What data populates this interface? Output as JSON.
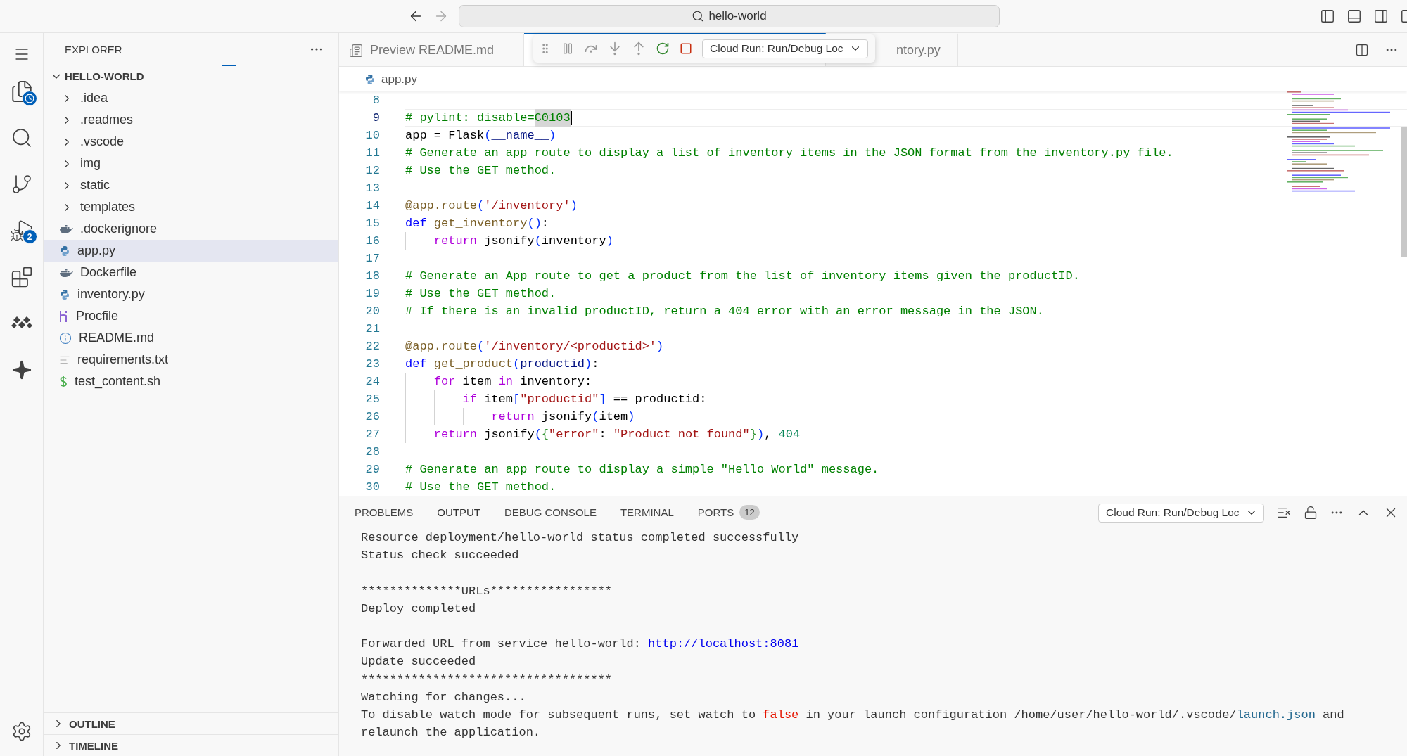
{
  "title_bar": {
    "search": "hello-world"
  },
  "activity_bar": {
    "run_badge": "2"
  },
  "explorer": {
    "title": "EXPLORER",
    "folder": "HELLO-WORLD",
    "items": [
      {
        "name": ".idea",
        "kind": "folder",
        "selected": false
      },
      {
        "name": ".readmes",
        "kind": "folder",
        "selected": false
      },
      {
        "name": ".vscode",
        "kind": "folder",
        "selected": false
      },
      {
        "name": "img",
        "kind": "folder",
        "selected": false
      },
      {
        "name": "static",
        "kind": "folder",
        "selected": false
      },
      {
        "name": "templates",
        "kind": "folder",
        "selected": false
      },
      {
        "name": ".dockerignore",
        "kind": "docker",
        "selected": false
      },
      {
        "name": "app.py",
        "kind": "python",
        "selected": true
      },
      {
        "name": "Dockerfile",
        "kind": "docker",
        "selected": false
      },
      {
        "name": "inventory.py",
        "kind": "python",
        "selected": false
      },
      {
        "name": "Procfile",
        "kind": "heroku",
        "selected": false
      },
      {
        "name": "README.md",
        "kind": "info",
        "selected": false
      },
      {
        "name": "requirements.txt",
        "kind": "text",
        "selected": false
      },
      {
        "name": "test_content.sh",
        "kind": "shell",
        "selected": false
      }
    ],
    "sections": [
      {
        "title": "OUTLINE"
      },
      {
        "title": "TIMELINE"
      }
    ]
  },
  "editor_tabs": [
    {
      "label": "Preview README.md",
      "kind": "preview",
      "selected": false
    },
    {
      "kind": "file",
      "selected": true
    },
    {
      "label": "ntory.py",
      "kind": "file",
      "selected": false
    }
  ],
  "debug_toolbar": {
    "configuration": "Cloud Run: Run/Debug Loc"
  },
  "breadcrumb": "app.py",
  "code": {
    "lines": [
      {
        "number": "8",
        "current": false
      },
      {
        "number": "9",
        "current": true,
        "tokens": [
          {
            "kind": "comment",
            "text": "# pylint: disable="
          },
          {
            "kind": "comment",
            "text": "C0103",
            "highlighted": true
          }
        ]
      },
      {
        "number": "10",
        "current": false,
        "tokens": [
          {
            "kind": "plain",
            "text": "app = Flask"
          },
          {
            "kind": "bracket",
            "text": "("
          },
          {
            "kind": "param",
            "text": "__name__"
          },
          {
            "kind": "bracket",
            "text": ")"
          }
        ]
      },
      {
        "number": "11",
        "current": false,
        "tokens": [
          {
            "kind": "comment",
            "text": "# Generate an app route to display a list of inventory items in the JSON format from the inventory.py file."
          }
        ]
      },
      {
        "number": "12",
        "current": false,
        "tokens": [
          {
            "kind": "comment",
            "text": "# Use the GET method."
          }
        ]
      },
      {
        "number": "13",
        "current": false
      },
      {
        "number": "14",
        "current": false,
        "tokens": [
          {
            "kind": "func",
            "text": "@app.route"
          },
          {
            "kind": "bracket",
            "text": "("
          },
          {
            "kind": "string",
            "text": "'/inventory'"
          },
          {
            "kind": "bracket",
            "text": ")"
          }
        ]
      },
      {
        "number": "15",
        "current": false,
        "tokens": [
          {
            "kind": "keyword",
            "text": "def "
          },
          {
            "kind": "func",
            "text": "get_inventory"
          },
          {
            "kind": "bracket",
            "text": "()"
          },
          {
            "kind": "plain",
            "text": ":"
          }
        ]
      },
      {
        "number": "16",
        "current": false,
        "tokens": [
          {
            "kind": "control",
            "text": "    return"
          },
          {
            "kind": "plain",
            "text": " jsonify"
          },
          {
            "kind": "bracket",
            "text": "("
          },
          {
            "kind": "plain",
            "text": "inventory"
          },
          {
            "kind": "bracket",
            "text": ")"
          }
        ]
      },
      {
        "number": "17",
        "current": false
      },
      {
        "number": "18",
        "current": false,
        "tokens": [
          {
            "kind": "comment",
            "text": "# Generate an App route to get a product from the list of inventory items given the productID."
          }
        ]
      },
      {
        "number": "19",
        "current": false,
        "tokens": [
          {
            "kind": "comment",
            "text": "# Use the GET method."
          }
        ]
      },
      {
        "number": "20",
        "current": false,
        "tokens": [
          {
            "kind": "comment",
            "text": "# If there is an invalid productID, return a 404 error with an error message in the JSON."
          }
        ]
      },
      {
        "number": "21",
        "current": false
      },
      {
        "number": "22",
        "current": false,
        "tokens": [
          {
            "kind": "func",
            "text": "@app.route"
          },
          {
            "kind": "bracket",
            "text": "("
          },
          {
            "kind": "string",
            "text": "'/inventory/<productid>'"
          },
          {
            "kind": "bracket",
            "text": ")"
          }
        ]
      },
      {
        "number": "23",
        "current": false,
        "tokens": [
          {
            "kind": "keyword",
            "text": "def "
          },
          {
            "kind": "func",
            "text": "get_product"
          },
          {
            "kind": "bracket",
            "text": "("
          },
          {
            "kind": "param",
            "text": "productid"
          },
          {
            "kind": "bracket",
            "text": ")"
          },
          {
            "kind": "plain",
            "text": ":"
          }
        ]
      },
      {
        "number": "24",
        "current": false,
        "tokens": [
          {
            "kind": "control",
            "text": "    for"
          },
          {
            "kind": "plain",
            "text": " item "
          },
          {
            "kind": "control",
            "text": "in"
          },
          {
            "kind": "plain",
            "text": " inventory:"
          }
        ]
      },
      {
        "number": "25",
        "current": false,
        "tokens": [
          {
            "kind": "control",
            "text": "        if"
          },
          {
            "kind": "plain",
            "text": " item"
          },
          {
            "kind": "bracket",
            "text": "["
          },
          {
            "kind": "string",
            "text": "\"productid\""
          },
          {
            "kind": "bracket",
            "text": "]"
          },
          {
            "kind": "plain",
            "text": " == productid:"
          }
        ]
      },
      {
        "number": "26",
        "current": false,
        "tokens": [
          {
            "kind": "control",
            "text": "            return"
          },
          {
            "kind": "plain",
            "text": " jsonify"
          },
          {
            "kind": "bracket",
            "text": "("
          },
          {
            "kind": "plain",
            "text": "item"
          },
          {
            "kind": "bracket",
            "text": ")"
          }
        ]
      },
      {
        "number": "27",
        "current": false,
        "tokens": [
          {
            "kind": "control",
            "text": "    return"
          },
          {
            "kind": "plain",
            "text": " jsonify"
          },
          {
            "kind": "bracket",
            "text": "("
          },
          {
            "kind": "brace",
            "text": "{"
          },
          {
            "kind": "string",
            "text": "\"error\""
          },
          {
            "kind": "plain",
            "text": ": "
          },
          {
            "kind": "string",
            "text": "\"Product not found\""
          },
          {
            "kind": "brace",
            "text": "}"
          },
          {
            "kind": "bracket",
            "text": ")"
          },
          {
            "kind": "plain",
            "text": ", "
          },
          {
            "kind": "number",
            "text": "404"
          }
        ]
      },
      {
        "number": "28",
        "current": false
      },
      {
        "number": "29",
        "current": false,
        "tokens": [
          {
            "kind": "comment",
            "text": "# Generate an app route to display a simple \"Hello World\" message."
          }
        ]
      },
      {
        "number": "30",
        "current": false,
        "tokens": [
          {
            "kind": "comment",
            "text": "# Use the GET method."
          }
        ]
      }
    ]
  },
  "panel": {
    "tabs": [
      {
        "label": "PROBLEMS",
        "selected": false
      },
      {
        "label": "OUTPUT",
        "selected": true
      },
      {
        "label": "DEBUG CONSOLE",
        "selected": false
      },
      {
        "label": "TERMINAL",
        "selected": false
      },
      {
        "label": "PORTS",
        "selected": false,
        "badge": "12"
      }
    ],
    "channel": "Cloud Run: Run/Debug Loc",
    "output": [
      {
        "segments": [
          {
            "kind": "text",
            "text": "Resource deployment/hello-world status completed successfully"
          }
        ]
      },
      {
        "segments": [
          {
            "kind": "text",
            "text": "Status check succeeded"
          }
        ]
      },
      {
        "kind": "blank"
      },
      {
        "segments": [
          {
            "kind": "text",
            "text": "**************URLs*****************"
          }
        ]
      },
      {
        "segments": [
          {
            "kind": "text",
            "text": "Deploy completed"
          }
        ]
      },
      {
        "kind": "blank"
      },
      {
        "segments": [
          {
            "kind": "text",
            "text": "Forwarded URL from service hello-world: "
          },
          {
            "kind": "link",
            "text": "http://localhost:8081"
          }
        ]
      },
      {
        "segments": [
          {
            "kind": "text",
            "text": "Update succeeded"
          }
        ]
      },
      {
        "segments": [
          {
            "kind": "text",
            "text": "***********************************"
          }
        ]
      },
      {
        "segments": [
          {
            "kind": "text",
            "text": "Watching for changes..."
          }
        ]
      },
      {
        "segments": [
          {
            "kind": "text",
            "text": "To disable watch mode for subsequent runs, set watch to "
          },
          {
            "kind": "literal",
            "text": "false"
          },
          {
            "kind": "text",
            "text": " in your launch configuration "
          },
          {
            "kind": "path",
            "text": "/home/user/hello-world/.vscode/"
          },
          {
            "kind": "file",
            "text": "launch.json"
          },
          {
            "kind": "text",
            "text": " and"
          }
        ]
      },
      {
        "segments": [
          {
            "kind": "text",
            "text": "relaunch the application."
          }
        ]
      }
    ]
  }
}
